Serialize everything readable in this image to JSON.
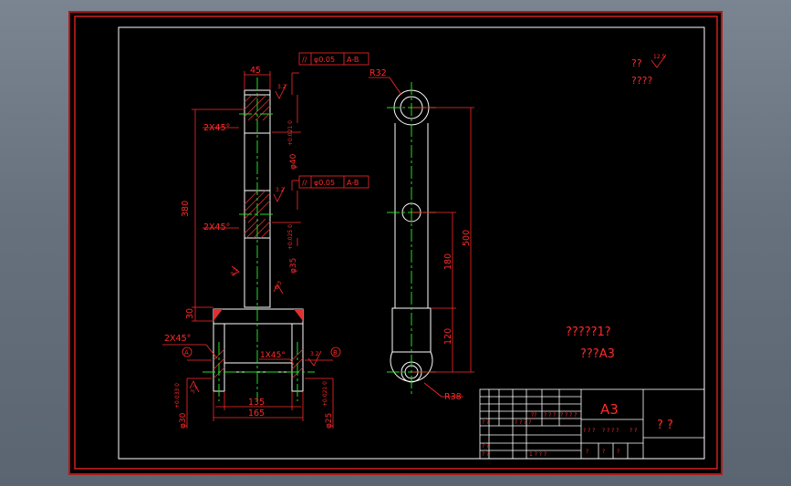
{
  "colors": {
    "canvas": "#000000",
    "dimension": "#ff2a2a",
    "geometry": "#ffffff",
    "centerline": "#22dd22",
    "hatch": "#e03030",
    "border": "#ffffff",
    "viewport_bg": "#6a7581"
  },
  "left_view": {
    "dims": {
      "top_width": "45",
      "overall_height": "380",
      "bottom_height": "30",
      "base_inner": "135",
      "base_outer": "165",
      "chamfer_a": "2X45°",
      "chamfer_b": "2X45°",
      "chamfer_c": "2X45°",
      "chamfer_d": "1X45°",
      "dia_top": "φ40",
      "dia_top_tol": "+0.021 0",
      "dia_mid": "φ35",
      "dia_mid_tol": "+0.025 0",
      "dia_left": "φ30",
      "dia_left_tol": "+0.033 0",
      "dia_right": "φ25",
      "dia_right_tol": "+0.021 0"
    },
    "tolerance_frames": [
      {
        "symbol": "//",
        "value": "φ0.05",
        "datum": "A-B"
      },
      {
        "symbol": "//",
        "value": "φ0.05",
        "datum": "A-B"
      }
    ],
    "surface_marks": [
      "3.2",
      "3.2",
      "3.2",
      "6.3",
      "3.2",
      "3.2"
    ],
    "datums": [
      "A",
      "B"
    ]
  },
  "right_view": {
    "dims": {
      "radius_top": "R32",
      "radius_bottom": "R38",
      "overall": "500",
      "mid": "180",
      "lower": "120"
    }
  },
  "notes": {
    "roughness_label": "??",
    "roughness_value": "12.5",
    "roughness_sub": "????",
    "line1": "?????1?",
    "line2": "???A3"
  },
  "title_block": {
    "sheet_size": "A3",
    "title": "? ?",
    "cells": [
      "? ?",
      "? ? ? ?",
      "??",
      "? ? ?",
      "? ? ? ?",
      "? ? ?",
      "? ? ? ?",
      "? ?",
      "? ?",
      "? ?",
      "1 ? ? ?",
      "?",
      "?",
      "?"
    ]
  }
}
